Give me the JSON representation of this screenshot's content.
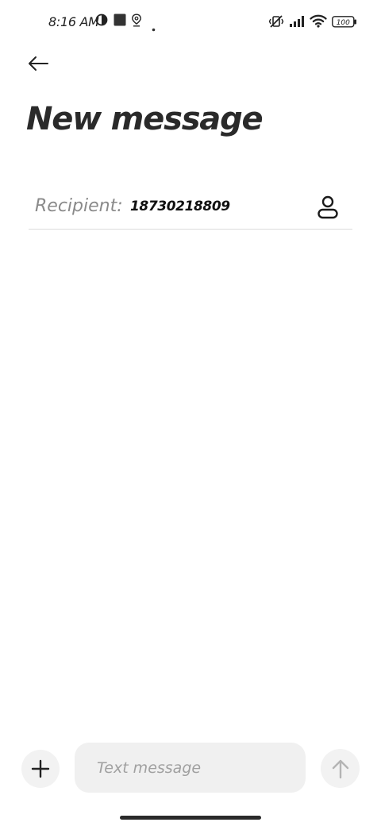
{
  "status_bar": {
    "time": "8:16 AM",
    "battery": "100",
    "icons": [
      "data-saver-icon",
      "square-notification-icon",
      "location-icon",
      "dot-icon",
      "vibrate-off-icon",
      "signal-icon",
      "wifi-icon",
      "battery-icon"
    ]
  },
  "header": {
    "title": "New message"
  },
  "recipient": {
    "label": "Recipient:",
    "value": "18730218809"
  },
  "composer": {
    "placeholder": "Text message",
    "value": ""
  },
  "colors": {
    "background": "#ffffff",
    "text": "#222222",
    "muted": "#8a8a8a",
    "field_bg": "#f0f0f0",
    "send_disabled": "#b4b4b4"
  }
}
